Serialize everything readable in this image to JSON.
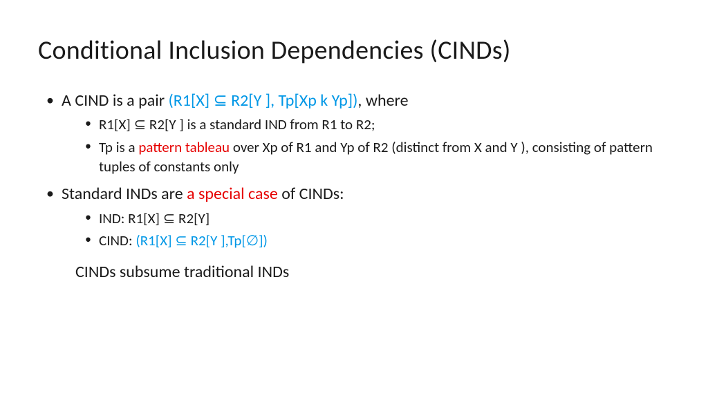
{
  "title": "Conditional Inclusion Dependencies (CINDs)",
  "b1": {
    "pre": "A CIND is a pair ",
    "formula": "(R1[X] ⊆ R2[Y ], Tp[Xp k Yp])",
    "post": ", where"
  },
  "b1s1": "R1[X] ⊆ R2[Y ] is a standard IND from R1 to R2;",
  "b1s2": {
    "pre": "Tp is a ",
    "highlight": "pattern tableau",
    "post": " over Xp of R1 and Yp of R2 (distinct from X and Y ), consisting of pattern tuples of constants only"
  },
  "b2": {
    "pre": "Standard INDs are ",
    "highlight": "a special case",
    "post": " of CINDs:"
  },
  "b2s1": "IND: R1[X] ⊆ R2[Y]",
  "b2s2": {
    "pre": "CIND: ",
    "formula": "(R1[X] ⊆ R2[Y ],Tp[∅])"
  },
  "closing": "CINDs subsume traditional INDs"
}
